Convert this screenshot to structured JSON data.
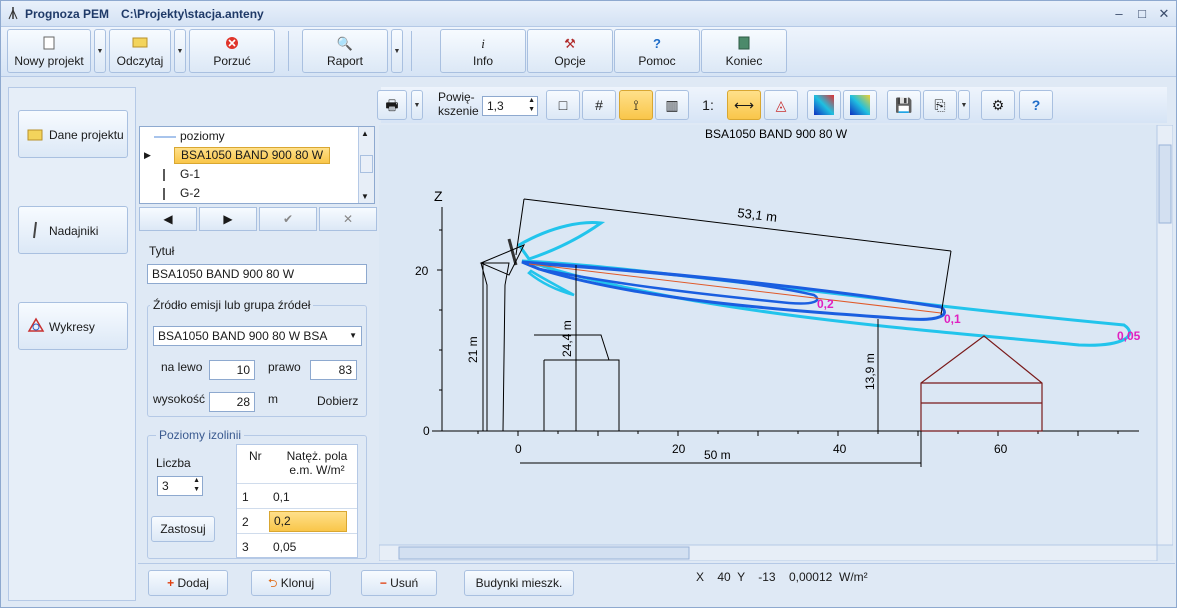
{
  "titlebar": {
    "app": "Prognoza PEM",
    "path": "C:\\Projekty\\stacja.anteny"
  },
  "toolbar": {
    "new": "Nowy projekt",
    "open": "Odczytaj",
    "discard": "Porzuć",
    "report": "Raport",
    "info": "Info",
    "options": "Opcje",
    "help": "Pomoc",
    "end": "Koniec"
  },
  "left": {
    "project": "Dane projektu",
    "transmitters": "Nadajniki",
    "charts": "Wykresy"
  },
  "list": {
    "items": [
      "poziomy",
      "BSA1050 BAND 900 80 W",
      "G-1",
      "G-2"
    ]
  },
  "form": {
    "title_label": "Tytuł",
    "title_value": "BSA1050 BAND 900 80 W",
    "source_label": "Źródło emisji lub grupa źródeł",
    "source_value": "BSA1050 BAND 900 80 W BSA",
    "left_label": "na lewo",
    "left_value": "10",
    "right_label": "prawo",
    "right_value": "83",
    "height_label": "wysokość",
    "height_value": "28",
    "height_unit": "m",
    "fit": "Dobierz"
  },
  "isolines": {
    "group": "Poziomy izolinii",
    "count_label": "Liczba",
    "count_value": "3",
    "apply": "Zastosuj",
    "col_nr": "Nr",
    "col_val": "Natęż. pola e.m. W/m²",
    "rows": [
      {
        "nr": "1",
        "v": "0,1"
      },
      {
        "nr": "2",
        "v": "0,2"
      },
      {
        "nr": "3",
        "v": "0,05"
      }
    ]
  },
  "rtool": {
    "zoom_label": "Powię-\nkszenie",
    "zoom_value": "1,3",
    "scale": "1:"
  },
  "plot": {
    "title": "BSA1050 BAND 900 80 W",
    "axis_z": "Z",
    "y_ticks": [
      "20",
      "0"
    ],
    "x_ticks": [
      "0",
      "20",
      "40",
      "60"
    ],
    "dim_53": "53,1 m",
    "dim_50": "50 m",
    "dim_21": "21 m",
    "dim_244": "24,4 m",
    "dim_139": "13,9 m",
    "iso_02": "0,2",
    "iso_01": "0,1",
    "iso_005": "0,05"
  },
  "bottom": {
    "add": "Dodaj",
    "clone": "Klonuj",
    "remove": "Usuń",
    "buildings": "Budynki mieszk.",
    "status": "X    40  Y    -13    0,00012  W/m²"
  }
}
